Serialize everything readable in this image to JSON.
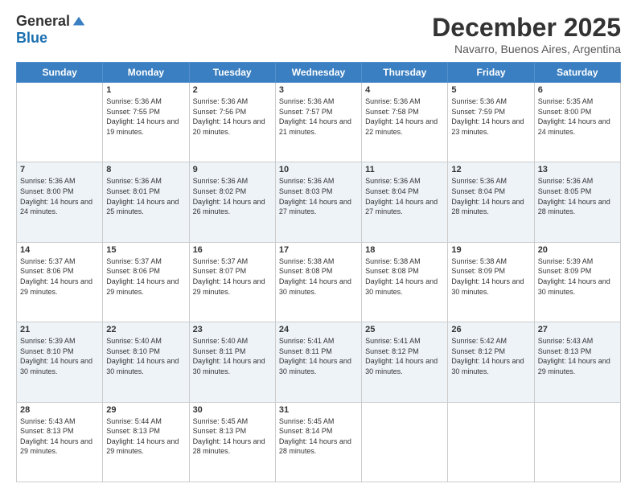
{
  "logo": {
    "general": "General",
    "blue": "Blue"
  },
  "header": {
    "month": "December 2025",
    "location": "Navarro, Buenos Aires, Argentina"
  },
  "weekdays": [
    "Sunday",
    "Monday",
    "Tuesday",
    "Wednesday",
    "Thursday",
    "Friday",
    "Saturday"
  ],
  "weeks": [
    [
      {
        "day": "",
        "sunrise": "",
        "sunset": "",
        "daylight": ""
      },
      {
        "day": "1",
        "sunrise": "Sunrise: 5:36 AM",
        "sunset": "Sunset: 7:55 PM",
        "daylight": "Daylight: 14 hours and 19 minutes."
      },
      {
        "day": "2",
        "sunrise": "Sunrise: 5:36 AM",
        "sunset": "Sunset: 7:56 PM",
        "daylight": "Daylight: 14 hours and 20 minutes."
      },
      {
        "day": "3",
        "sunrise": "Sunrise: 5:36 AM",
        "sunset": "Sunset: 7:57 PM",
        "daylight": "Daylight: 14 hours and 21 minutes."
      },
      {
        "day": "4",
        "sunrise": "Sunrise: 5:36 AM",
        "sunset": "Sunset: 7:58 PM",
        "daylight": "Daylight: 14 hours and 22 minutes."
      },
      {
        "day": "5",
        "sunrise": "Sunrise: 5:36 AM",
        "sunset": "Sunset: 7:59 PM",
        "daylight": "Daylight: 14 hours and 23 minutes."
      },
      {
        "day": "6",
        "sunrise": "Sunrise: 5:35 AM",
        "sunset": "Sunset: 8:00 PM",
        "daylight": "Daylight: 14 hours and 24 minutes."
      }
    ],
    [
      {
        "day": "7",
        "sunrise": "Sunrise: 5:36 AM",
        "sunset": "Sunset: 8:00 PM",
        "daylight": "Daylight: 14 hours and 24 minutes."
      },
      {
        "day": "8",
        "sunrise": "Sunrise: 5:36 AM",
        "sunset": "Sunset: 8:01 PM",
        "daylight": "Daylight: 14 hours and 25 minutes."
      },
      {
        "day": "9",
        "sunrise": "Sunrise: 5:36 AM",
        "sunset": "Sunset: 8:02 PM",
        "daylight": "Daylight: 14 hours and 26 minutes."
      },
      {
        "day": "10",
        "sunrise": "Sunrise: 5:36 AM",
        "sunset": "Sunset: 8:03 PM",
        "daylight": "Daylight: 14 hours and 27 minutes."
      },
      {
        "day": "11",
        "sunrise": "Sunrise: 5:36 AM",
        "sunset": "Sunset: 8:04 PM",
        "daylight": "Daylight: 14 hours and 27 minutes."
      },
      {
        "day": "12",
        "sunrise": "Sunrise: 5:36 AM",
        "sunset": "Sunset: 8:04 PM",
        "daylight": "Daylight: 14 hours and 28 minutes."
      },
      {
        "day": "13",
        "sunrise": "Sunrise: 5:36 AM",
        "sunset": "Sunset: 8:05 PM",
        "daylight": "Daylight: 14 hours and 28 minutes."
      }
    ],
    [
      {
        "day": "14",
        "sunrise": "Sunrise: 5:37 AM",
        "sunset": "Sunset: 8:06 PM",
        "daylight": "Daylight: 14 hours and 29 minutes."
      },
      {
        "day": "15",
        "sunrise": "Sunrise: 5:37 AM",
        "sunset": "Sunset: 8:06 PM",
        "daylight": "Daylight: 14 hours and 29 minutes."
      },
      {
        "day": "16",
        "sunrise": "Sunrise: 5:37 AM",
        "sunset": "Sunset: 8:07 PM",
        "daylight": "Daylight: 14 hours and 29 minutes."
      },
      {
        "day": "17",
        "sunrise": "Sunrise: 5:38 AM",
        "sunset": "Sunset: 8:08 PM",
        "daylight": "Daylight: 14 hours and 30 minutes."
      },
      {
        "day": "18",
        "sunrise": "Sunrise: 5:38 AM",
        "sunset": "Sunset: 8:08 PM",
        "daylight": "Daylight: 14 hours and 30 minutes."
      },
      {
        "day": "19",
        "sunrise": "Sunrise: 5:38 AM",
        "sunset": "Sunset: 8:09 PM",
        "daylight": "Daylight: 14 hours and 30 minutes."
      },
      {
        "day": "20",
        "sunrise": "Sunrise: 5:39 AM",
        "sunset": "Sunset: 8:09 PM",
        "daylight": "Daylight: 14 hours and 30 minutes."
      }
    ],
    [
      {
        "day": "21",
        "sunrise": "Sunrise: 5:39 AM",
        "sunset": "Sunset: 8:10 PM",
        "daylight": "Daylight: 14 hours and 30 minutes."
      },
      {
        "day": "22",
        "sunrise": "Sunrise: 5:40 AM",
        "sunset": "Sunset: 8:10 PM",
        "daylight": "Daylight: 14 hours and 30 minutes."
      },
      {
        "day": "23",
        "sunrise": "Sunrise: 5:40 AM",
        "sunset": "Sunset: 8:11 PM",
        "daylight": "Daylight: 14 hours and 30 minutes."
      },
      {
        "day": "24",
        "sunrise": "Sunrise: 5:41 AM",
        "sunset": "Sunset: 8:11 PM",
        "daylight": "Daylight: 14 hours and 30 minutes."
      },
      {
        "day": "25",
        "sunrise": "Sunrise: 5:41 AM",
        "sunset": "Sunset: 8:12 PM",
        "daylight": "Daylight: 14 hours and 30 minutes."
      },
      {
        "day": "26",
        "sunrise": "Sunrise: 5:42 AM",
        "sunset": "Sunset: 8:12 PM",
        "daylight": "Daylight: 14 hours and 30 minutes."
      },
      {
        "day": "27",
        "sunrise": "Sunrise: 5:43 AM",
        "sunset": "Sunset: 8:13 PM",
        "daylight": "Daylight: 14 hours and 29 minutes."
      }
    ],
    [
      {
        "day": "28",
        "sunrise": "Sunrise: 5:43 AM",
        "sunset": "Sunset: 8:13 PM",
        "daylight": "Daylight: 14 hours and 29 minutes."
      },
      {
        "day": "29",
        "sunrise": "Sunrise: 5:44 AM",
        "sunset": "Sunset: 8:13 PM",
        "daylight": "Daylight: 14 hours and 29 minutes."
      },
      {
        "day": "30",
        "sunrise": "Sunrise: 5:45 AM",
        "sunset": "Sunset: 8:13 PM",
        "daylight": "Daylight: 14 hours and 28 minutes."
      },
      {
        "day": "31",
        "sunrise": "Sunrise: 5:45 AM",
        "sunset": "Sunset: 8:14 PM",
        "daylight": "Daylight: 14 hours and 28 minutes."
      },
      {
        "day": "",
        "sunrise": "",
        "sunset": "",
        "daylight": ""
      },
      {
        "day": "",
        "sunrise": "",
        "sunset": "",
        "daylight": ""
      },
      {
        "day": "",
        "sunrise": "",
        "sunset": "",
        "daylight": ""
      }
    ]
  ]
}
